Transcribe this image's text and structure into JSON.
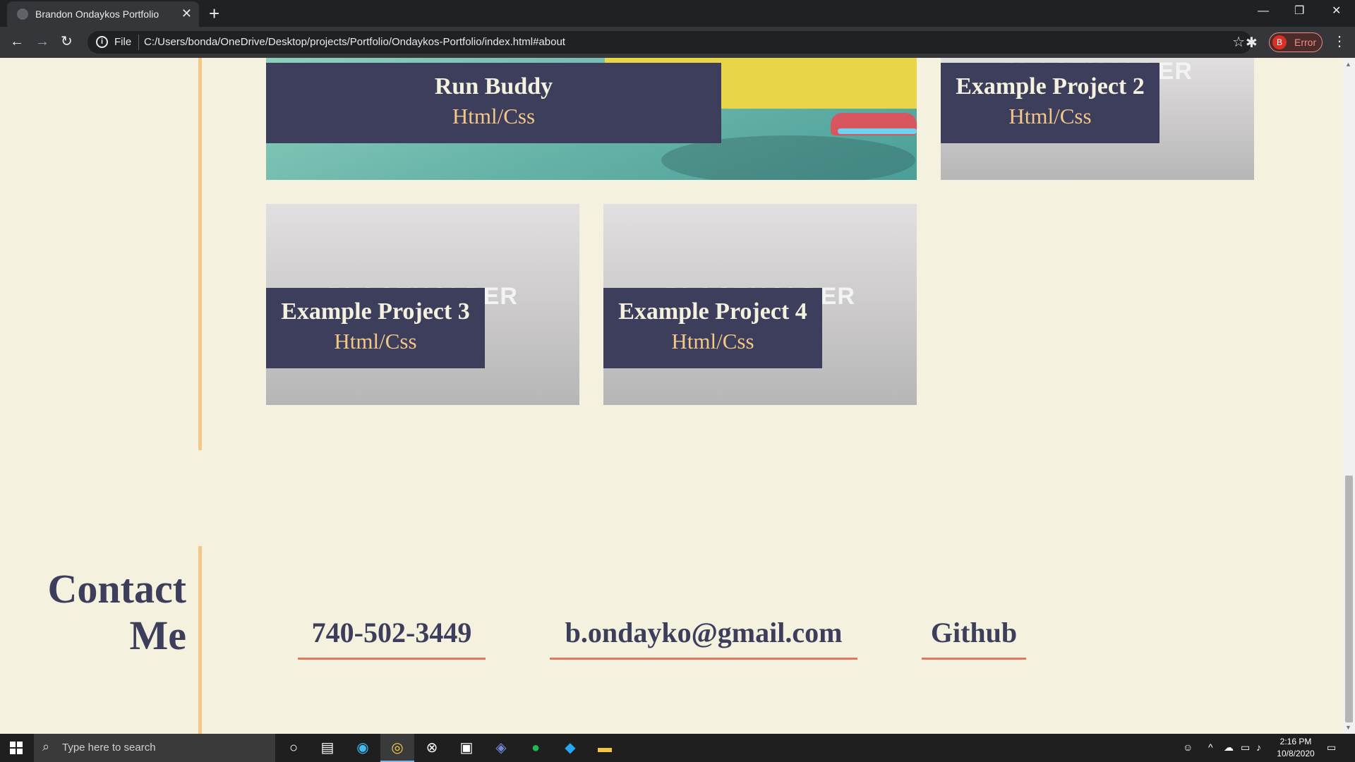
{
  "browser": {
    "tab_title": "Brandon Ondaykos Portfolio",
    "tab_close": "✕",
    "new_tab": "+",
    "scheme_label": "File",
    "url": "C:/Users/bonda/OneDrive/Desktop/projects/Portfolio/Ondaykos-Portfolio/index.html#about",
    "profile_initial": "B",
    "profile_status": "Error",
    "icons": [
      "back-icon",
      "forward-icon",
      "reload-icon",
      "info-icon",
      "star-icon",
      "extensions-icon",
      "menu-icon"
    ]
  },
  "projects": [
    {
      "name": "Run Buddy",
      "tech": "Html/Css"
    },
    {
      "name": "Example Project 2",
      "tech": "Html/Css",
      "placeholder": "PLACEHOLDER"
    },
    {
      "name": "Example Project 3",
      "tech": "Html/Css",
      "placeholder": "PLACEHOLDER"
    },
    {
      "name": "Example Project 4",
      "tech": "Html/Css",
      "placeholder": "PLACEHOLDER"
    }
  ],
  "contact": {
    "heading_line1": "Contact",
    "heading_line2": "Me",
    "phone": "740-502-3449",
    "email": "b.ondayko@gmail.com",
    "github": "Github",
    "accent_color": "#e07a5f"
  },
  "colors": {
    "page_bg": "#f4f1df",
    "label_bg": "#3d3e5c",
    "label_tech": "#f3c786",
    "divider": "#f3c786"
  },
  "taskbar": {
    "search_placeholder": "Type here to search",
    "time": "2:16 PM",
    "date": "10/8/2020"
  }
}
